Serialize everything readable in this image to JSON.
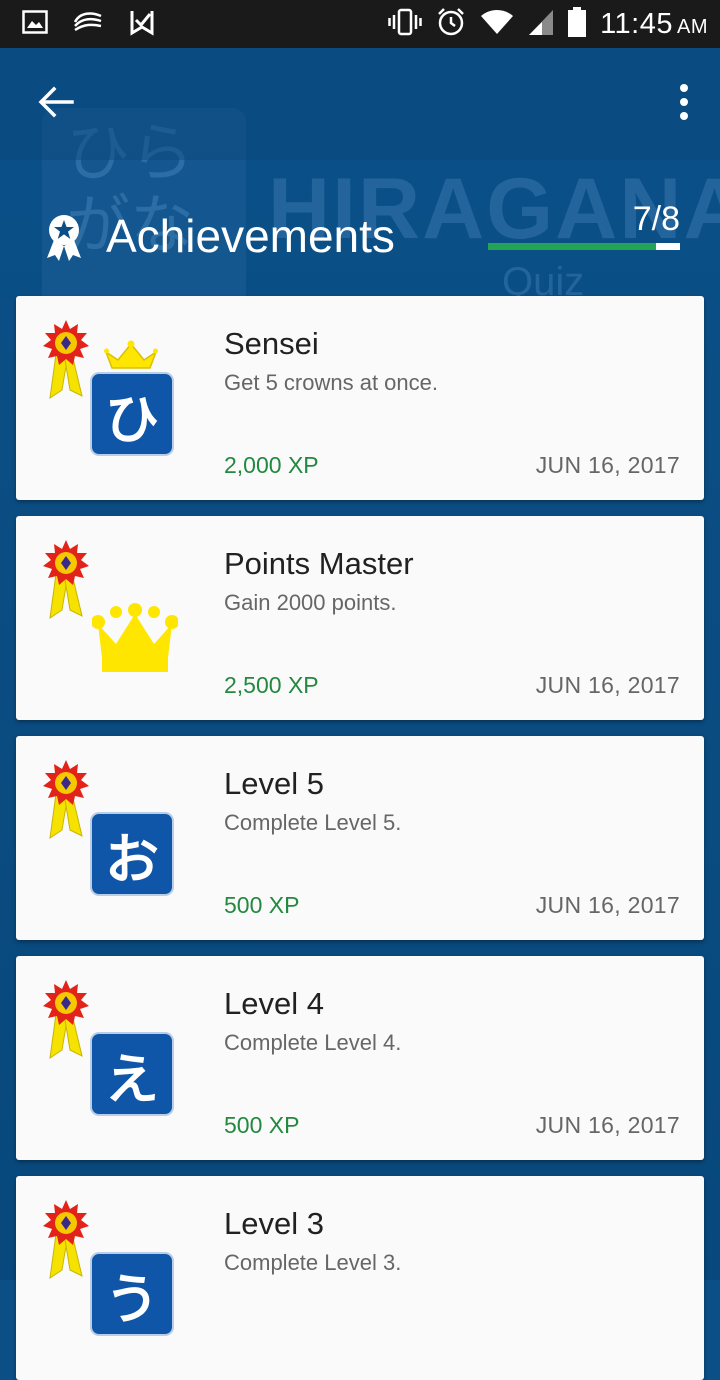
{
  "status_bar": {
    "time": "11:45",
    "ampm": "AM",
    "left_icons": [
      "image-icon",
      "swiftkey-icon",
      "check-flag-icon"
    ],
    "right_icons": [
      "vibrate-icon",
      "alarm-icon",
      "wifi-icon",
      "signal-icon",
      "battery-icon"
    ]
  },
  "background": {
    "title": "HIRAGANA",
    "subtitle": "Quiz",
    "tile_glyphs": "ひら\nがな"
  },
  "toolbar": {
    "back_icon": "arrow-back-icon",
    "menu_icon": "more-vert-icon"
  },
  "header": {
    "icon": "award-ribbon-icon",
    "title": "Achievements",
    "progress_text": "7/8",
    "progress_fraction": 0.875,
    "colors": {
      "progress_fill": "#23a455",
      "progress_track": "#ffffff"
    }
  },
  "achievements": [
    {
      "title": "Sensei",
      "description": "Get 5 crowns at once.",
      "xp": "2,000 XP",
      "date": "JUN 16, 2017",
      "emblem": "ひ",
      "emblem_type": "kana-tile-with-crown"
    },
    {
      "title": "Points Master",
      "description": "Gain 2000 points.",
      "xp": "2,500 XP",
      "date": "JUN 16, 2017",
      "emblem": "",
      "emblem_type": "crown"
    },
    {
      "title": "Level 5",
      "description": "Complete Level 5.",
      "xp": "500 XP",
      "date": "JUN 16, 2017",
      "emblem": "お",
      "emblem_type": "kana-tile"
    },
    {
      "title": "Level 4",
      "description": "Complete Level 4.",
      "xp": "500 XP",
      "date": "JUN 16, 2017",
      "emblem": "え",
      "emblem_type": "kana-tile"
    },
    {
      "title": "Level 3",
      "description": "Complete Level 3.",
      "xp": "",
      "date": "",
      "emblem": "う",
      "emblem_type": "kana-tile"
    }
  ],
  "colors": {
    "app_blue": "#0b4f86",
    "xp_green": "#23893f",
    "tile_blue": "#0f56a8",
    "crown_yellow": "#ffe600"
  }
}
